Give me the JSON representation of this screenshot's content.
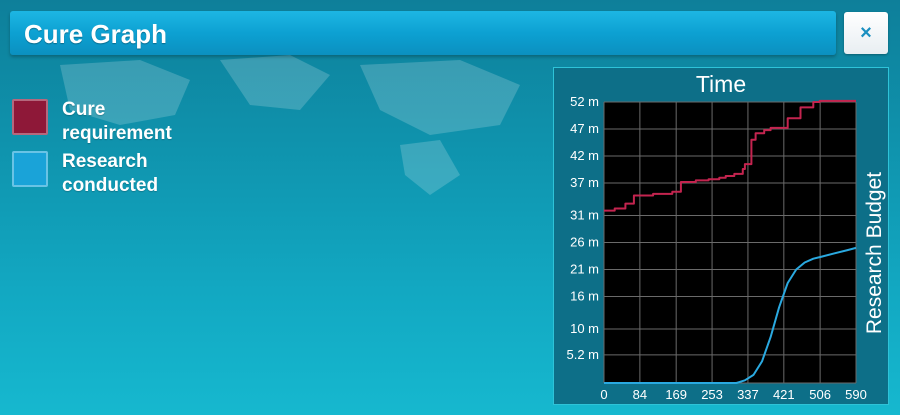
{
  "header": {
    "title": "Cure Graph",
    "close_label": "×"
  },
  "legend": [
    {
      "label_line1": "Cure",
      "label_line2": "requirement",
      "color": "#8e1838"
    },
    {
      "label_line1": "Research",
      "label_line2": "conducted",
      "color": "#1aa3d8"
    }
  ],
  "colors": {
    "accent": "#0da1d2",
    "cure_line": "#c4244f",
    "research_line": "#2aa9e0",
    "plot_bg": "#000000"
  },
  "chart_data": {
    "type": "line",
    "title": "Time",
    "xlabel": "",
    "ylabel": "Research Budget",
    "xlim": [
      0,
      590
    ],
    "ylim": [
      0,
      52
    ],
    "x_ticks": [
      "0",
      "84",
      "169",
      "253",
      "337",
      "421",
      "506",
      "590"
    ],
    "x_tick_values": [
      0,
      84,
      169,
      253,
      337,
      421,
      506,
      590
    ],
    "y_ticks": [
      "52 m",
      "47 m",
      "42 m",
      "37 m",
      "31 m",
      "26 m",
      "21 m",
      "16 m",
      "10 m",
      "5.2 m"
    ],
    "y_tick_values": [
      52,
      47,
      42,
      37,
      31,
      26,
      21,
      16,
      10,
      5.2
    ],
    "grid": true,
    "legend_position": "left-outside",
    "series": [
      {
        "name": "Cure requirement",
        "color": "#c4244f",
        "x": [
          0,
          25,
          25,
          50,
          50,
          70,
          70,
          115,
          115,
          160,
          160,
          180,
          180,
          215,
          215,
          245,
          245,
          270,
          270,
          285,
          285,
          305,
          305,
          325,
          325,
          330,
          330,
          345,
          345,
          355,
          355,
          375,
          375,
          390,
          390,
          430,
          430,
          460,
          460,
          490,
          490,
          505,
          505,
          590
        ],
        "y": [
          31.9,
          31.9,
          32.3,
          32.3,
          33.2,
          33.2,
          34.7,
          34.7,
          35.0,
          35.0,
          35.4,
          35.4,
          37.2,
          37.2,
          37.5,
          37.5,
          37.7,
          37.7,
          38.0,
          38.0,
          38.3,
          38.3,
          38.7,
          38.7,
          39.6,
          39.6,
          40.5,
          40.5,
          45.0,
          45.0,
          46.2,
          46.2,
          46.8,
          46.8,
          47.2,
          47.2,
          49.0,
          49.0,
          51.0,
          51.0,
          52.0,
          52.0,
          52.2,
          52.2
        ]
      },
      {
        "name": "Research conducted",
        "color": "#2aa9e0",
        "x": [
          0,
          280,
          310,
          330,
          350,
          370,
          390,
          410,
          430,
          450,
          470,
          490,
          510,
          540,
          570,
          590
        ],
        "y": [
          0,
          0,
          0,
          0.5,
          1.5,
          4.0,
          8.5,
          14.0,
          18.5,
          21.0,
          22.3,
          23.0,
          23.4,
          24.0,
          24.6,
          25.0
        ]
      }
    ]
  }
}
